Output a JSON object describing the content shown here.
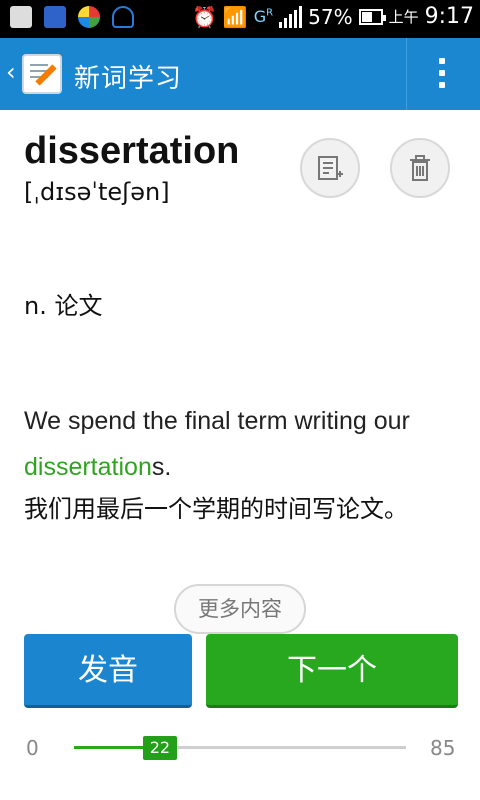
{
  "status_bar": {
    "network_label": "G",
    "network_sup": "R",
    "battery_text": "57%",
    "battery_level": 0.57,
    "time_prefix": "上午",
    "time": "9:17"
  },
  "app_bar": {
    "title": "新词学习",
    "back_icon": "chevron-left-icon",
    "menu_icon": "overflow-menu-icon",
    "color": "#1a87d0"
  },
  "word": {
    "headword": "dissertation",
    "phonetic": "[ˌdɪsəˈteʃən]",
    "meaning": "n. 论文",
    "example_before": "We spend the final term writing our ",
    "example_highlight": "dissertation",
    "example_after": "s.",
    "translation": "我们用最后一个学期的时间写论文。",
    "highlight_color": "#2fa51f"
  },
  "actions": {
    "add_icon": "add-to-notebook-icon",
    "delete_icon": "trash-icon",
    "more_label": "更多内容",
    "pronounce_label": "发音",
    "next_label": "下一个"
  },
  "progress": {
    "min": "0",
    "max": "85",
    "current": "22",
    "current_value": 22,
    "max_value": 85
  }
}
